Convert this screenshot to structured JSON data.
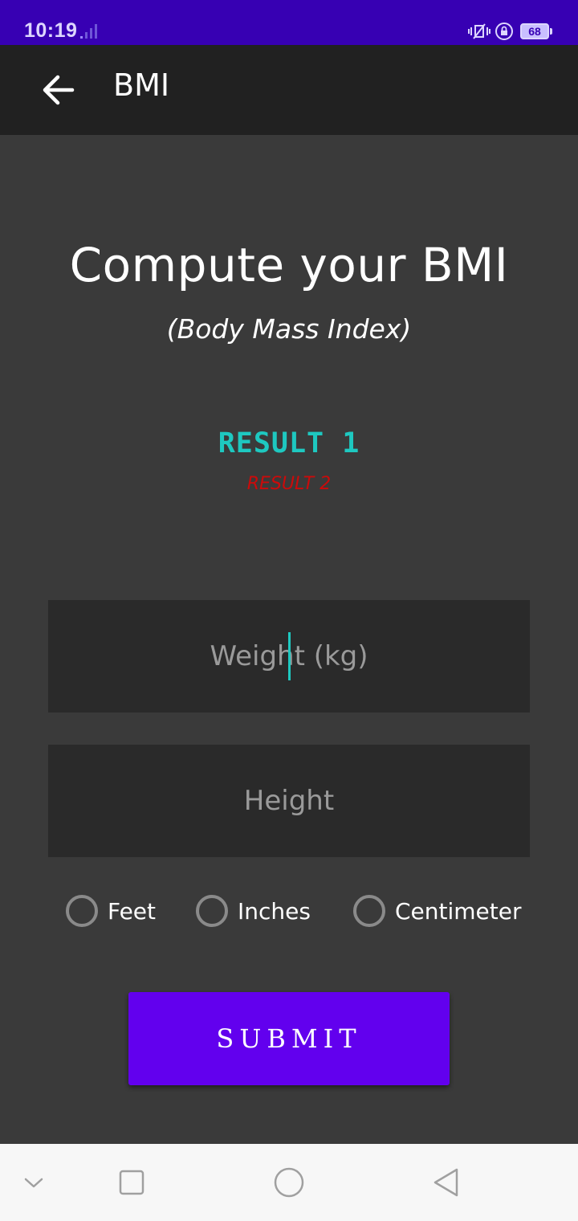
{
  "status_bar": {
    "time": "10:19",
    "battery": "68",
    "icons": [
      "signal-icon",
      "vibrate-icon",
      "rotation-lock-icon",
      "battery-icon"
    ]
  },
  "app_bar": {
    "title": "BMI",
    "back_icon": "arrow-back-icon"
  },
  "main": {
    "headline": "Compute your BMI",
    "subheadline": "(Body Mass Index)",
    "result1": "RESULT 1",
    "result2": "RESULT 2",
    "weight_placeholder": "Weight (kg)",
    "height_placeholder": "Height",
    "units": [
      "Feet",
      "Inches",
      "Centimeter"
    ],
    "submit_label": "SUBMIT"
  },
  "nav_bar": {
    "icons": [
      "chevron-down-icon",
      "recents-icon",
      "home-icon",
      "back-icon"
    ]
  },
  "colors": {
    "status_bar": "#3700b3",
    "app_bar": "#212121",
    "background": "#3a3a3a",
    "field": "#2a2a2a",
    "accent_teal": "#1ec8c0",
    "result2_red": "#cc0a0a",
    "submit": "#6200ee"
  }
}
